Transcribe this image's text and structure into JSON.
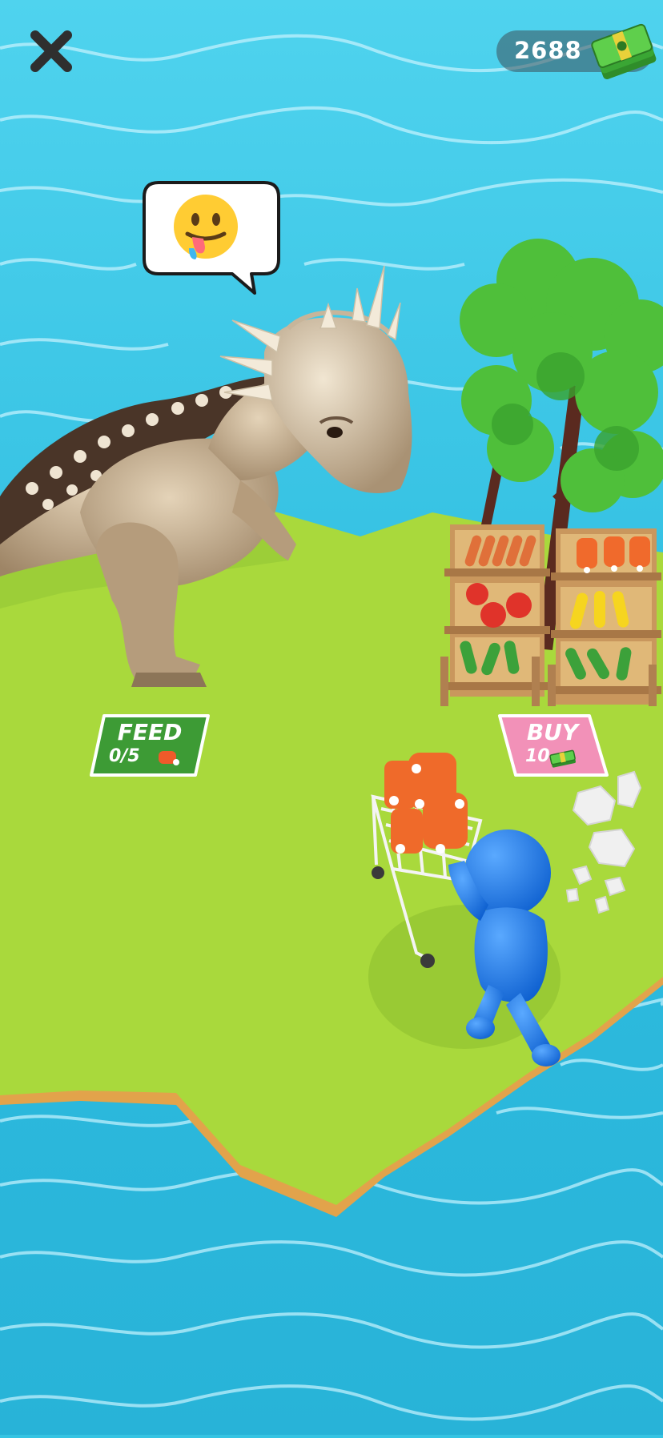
{
  "hud": {
    "close_icon": "close-x-icon",
    "money": "2688",
    "money_icon": "cash-stack-icon"
  },
  "speech_bubble": {
    "emoji": "drooling-face-emoji"
  },
  "feed_station": {
    "title": "FEED",
    "progress_text": "0/5",
    "progress": 0,
    "icon": "meat-icon",
    "color": "#3d9b35"
  },
  "buy_station": {
    "title": "BUY",
    "price": "10",
    "icon": "cash-icon",
    "color": "#f291b8"
  },
  "colors": {
    "water": "#36c4e3",
    "island": "#a9d93c",
    "player": "#1e78e8"
  }
}
